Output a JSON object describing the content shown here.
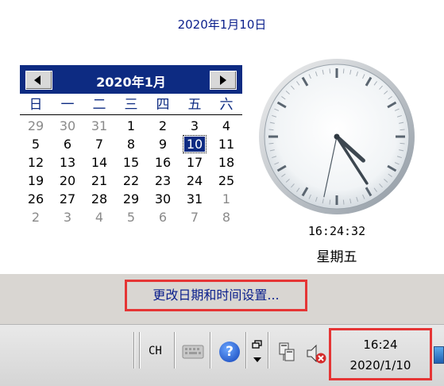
{
  "popup": {
    "date_header": "2020年1月10日",
    "calendar": {
      "month_title": "2020年1月",
      "weekdays": [
        "日",
        "一",
        "二",
        "三",
        "四",
        "五",
        "六"
      ],
      "weeks": [
        [
          "29",
          "30",
          "31",
          "1",
          "2",
          "3",
          "4"
        ],
        [
          "5",
          "6",
          "7",
          "8",
          "9",
          "10",
          "11"
        ],
        [
          "12",
          "13",
          "14",
          "15",
          "16",
          "17",
          "18"
        ],
        [
          "19",
          "20",
          "21",
          "22",
          "23",
          "24",
          "25"
        ],
        [
          "26",
          "27",
          "28",
          "29",
          "30",
          "31",
          "1"
        ],
        [
          "2",
          "3",
          "4",
          "5",
          "6",
          "7",
          "8"
        ]
      ],
      "selected_day": "10"
    },
    "clock": {
      "time": "16:24:32",
      "weekday": "星期五",
      "hour": 16,
      "minute": 24,
      "second": 32
    },
    "change_link": "更改日期和时间设置..."
  },
  "taskbar": {
    "language": "CH",
    "help_glyph": "?",
    "tray_clock": {
      "time": "16:24",
      "date": "2020/1/10"
    }
  },
  "colors": {
    "accent": "#0d2b82",
    "highlight_border": "#e53535",
    "link": "#0a1f8c"
  }
}
